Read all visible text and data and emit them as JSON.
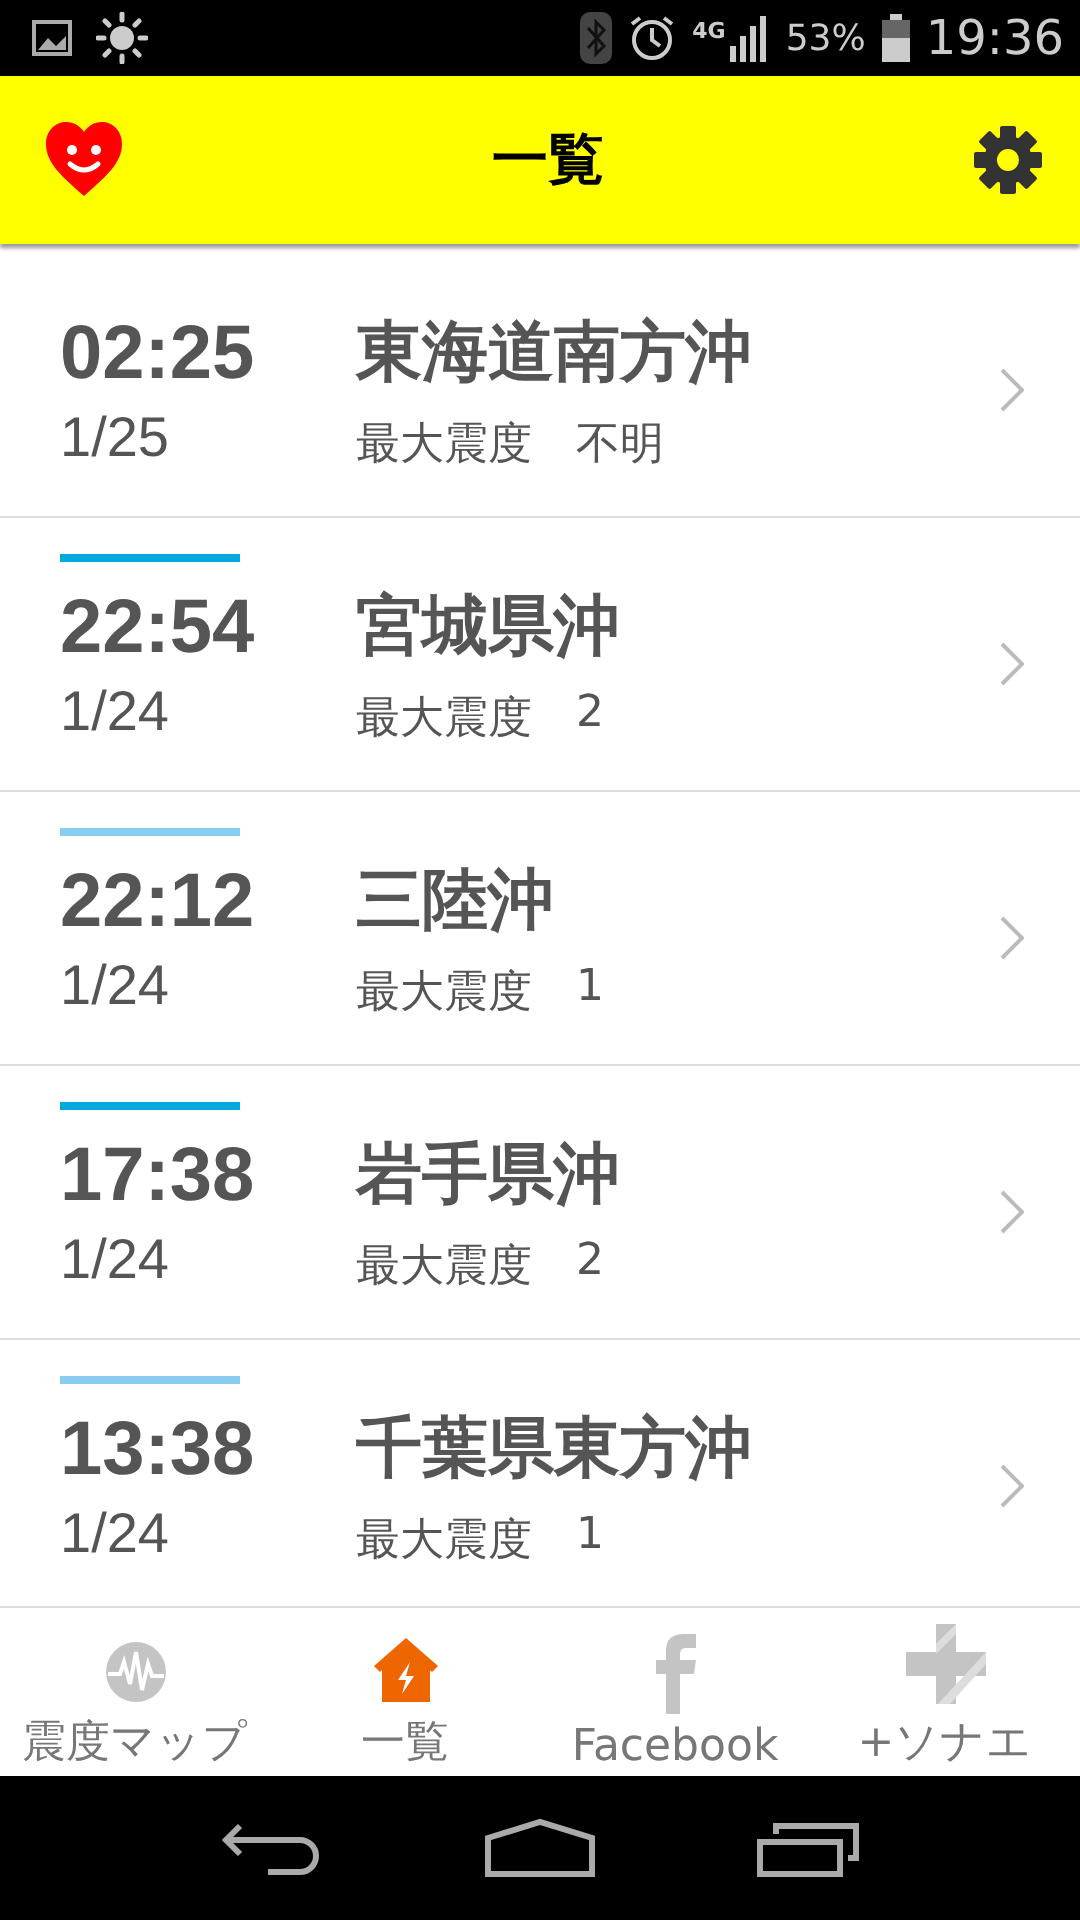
{
  "status_bar": {
    "network": "4G",
    "battery": "53%",
    "time": "19:36"
  },
  "app_bar": {
    "title": "一覧"
  },
  "quakes": [
    {
      "time": "02:25",
      "date": "1/25",
      "region": "東海道南方沖",
      "intensity_label": "最大震度",
      "intensity": "不明"
    },
    {
      "time": "22:54",
      "date": "1/24",
      "region": "宮城県沖",
      "intensity_label": "最大震度",
      "intensity": "2",
      "color": "#00aadd"
    },
    {
      "time": "22:12",
      "date": "1/24",
      "region": "三陸沖",
      "intensity_label": "最大震度",
      "intensity": "1",
      "color": "#88ccf0"
    },
    {
      "time": "17:38",
      "date": "1/24",
      "region": "岩手県沖",
      "intensity_label": "最大震度",
      "intensity": "2",
      "color": "#00aadd"
    },
    {
      "time": "13:38",
      "date": "1/24",
      "region": "千葉県東方沖",
      "intensity_label": "最大震度",
      "intensity": "1",
      "color": "#88ccf0"
    }
  ],
  "bottom_nav": [
    {
      "kind": "map",
      "label": "震度マップ",
      "selected": false
    },
    {
      "kind": "list",
      "label": "一覧",
      "selected": true
    },
    {
      "kind": "facebook",
      "label": "Facebook",
      "selected": false
    },
    {
      "kind": "sonae",
      "label": "+ソナエ",
      "selected": false
    }
  ]
}
